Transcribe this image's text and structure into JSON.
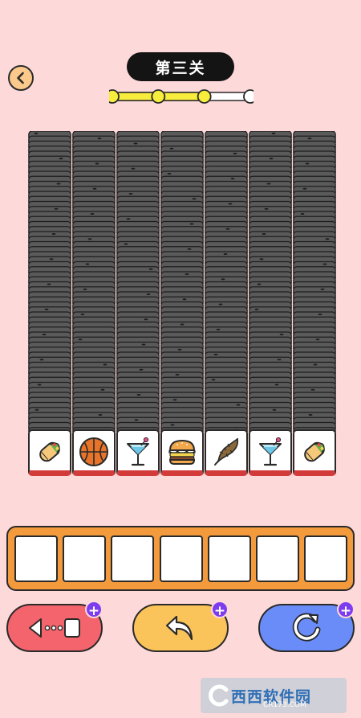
{
  "header": {
    "level_title": "第三关",
    "progress": {
      "completed": 3,
      "total": 4
    }
  },
  "board": {
    "columns": [
      {
        "top_card": "burrito-icon"
      },
      {
        "top_card": "basketball-icon"
      },
      {
        "top_card": "cocktail-icon"
      },
      {
        "top_card": "hamburger-icon"
      },
      {
        "top_card": "feather-icon"
      },
      {
        "top_card": "cocktail-icon"
      },
      {
        "top_card": "burrito-icon"
      }
    ]
  },
  "tray": {
    "slot_count": 7,
    "filled": 0
  },
  "toolbar": {
    "move_out": {
      "icon": "move-out-icon",
      "plus": "+"
    },
    "undo": {
      "icon": "undo-icon",
      "plus": "+"
    },
    "shuffle": {
      "icon": "shuffle-icon",
      "plus": "+"
    }
  },
  "colors": {
    "background": "#fed9d9",
    "card_back": "#5a5a5a",
    "card_red_edge": "#d33b3b",
    "tray": "#f39a3d",
    "move_out_button": "#f4646c",
    "undo_button": "#fbc45a",
    "shuffle_button": "#6a8cf8",
    "plus_badge": "#7e3cf0",
    "progress_fill": "#f8ec3c"
  },
  "watermark": {
    "text": "西西软件园",
    "sub": "CR173.COM"
  }
}
